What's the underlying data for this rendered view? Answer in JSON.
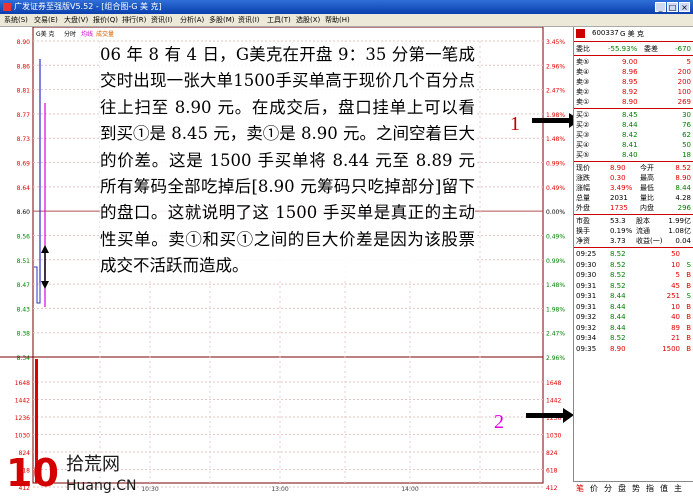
{
  "window": {
    "title": "广发证券至强版V5.52 - [组合图-G 美 克]",
    "buttons": [
      "_",
      "□",
      "×"
    ]
  },
  "menu": [
    "系统(S)",
    "交易(E)",
    "大盘(V)",
    "报价(Q)",
    "排行(R)",
    "资讯(I)",
    "分析(A)",
    "多股(M)",
    "资讯(I)",
    "工具(T)",
    "选股(X)",
    "帮助(H)"
  ],
  "chart_legend": {
    "name": "G美 克",
    "mode": "分时",
    "avg": "均线",
    "vol": "成交量"
  },
  "price_axis": [
    "8.90",
    "8.86",
    "8.81",
    "8.77",
    "8.73",
    "8.69",
    "8.64",
    "8.60",
    "8.56",
    "8.51",
    "8.47",
    "8.43",
    "8.38",
    "8.34"
  ],
  "pct_axis": [
    "3.45%",
    "2.96%",
    "2.47%",
    "1.98%",
    "1.48%",
    "0.99%",
    "0.49%",
    "0.00%",
    "0.49%",
    "0.99%",
    "1.48%",
    "1.98%",
    "2.47%",
    "2.96%"
  ],
  "vol_axis": [
    "1648",
    "1442",
    "1236",
    "1030",
    "824",
    "618",
    "412",
    "206"
  ],
  "time_axis": [
    "10:30",
    "13:00",
    "14:00"
  ],
  "panel": {
    "code": "600337",
    "name": "G 美 克",
    "weibi_label": "委比",
    "weibi_val": "-55.93%",
    "weicha_label": "委差",
    "weicha_val": "-670",
    "asks": [
      {
        "label": "卖⑤",
        "price": "9.00",
        "vol": "5"
      },
      {
        "label": "卖④",
        "price": "8.96",
        "vol": "200"
      },
      {
        "label": "卖③",
        "price": "8.95",
        "vol": "200"
      },
      {
        "label": "卖②",
        "price": "8.92",
        "vol": "100"
      },
      {
        "label": "卖①",
        "price": "8.90",
        "vol": "269"
      }
    ],
    "bids": [
      {
        "label": "买①",
        "price": "8.45",
        "vol": "30"
      },
      {
        "label": "买②",
        "price": "8.44",
        "vol": "76"
      },
      {
        "label": "买③",
        "price": "8.42",
        "vol": "62"
      },
      {
        "label": "买④",
        "price": "8.41",
        "vol": "50"
      },
      {
        "label": "买⑤",
        "price": "8.40",
        "vol": "18"
      }
    ],
    "stats": [
      {
        "l1": "现价",
        "v1": "8.90",
        "l2": "今开",
        "v2": "8.52"
      },
      {
        "l1": "涨跌",
        "v1": "0.30",
        "l2": "最高",
        "v2": "8.90"
      },
      {
        "l1": "涨幅",
        "v1": "3.49%",
        "l2": "最低",
        "v2": "8.44"
      },
      {
        "l1": "总量",
        "v1": "2031",
        "l2": "量比",
        "v2": "4.28"
      },
      {
        "l1": "外盘",
        "v1": "1735",
        "l2": "内盘",
        "v2": "296"
      }
    ],
    "fund": [
      {
        "l1": "市盈",
        "v1": "53.3",
        "l2": "股本",
        "v2": "1.99亿"
      },
      {
        "l1": "换手",
        "v1": "0.19%",
        "l2": "流通",
        "v2": "1.08亿"
      },
      {
        "l1": "净资",
        "v1": "3.73",
        "l2": "收益(一)",
        "v2": "0.04"
      }
    ],
    "ticks": [
      {
        "t": "09:25",
        "p": "8.52",
        "v": "50",
        "s": ""
      },
      {
        "t": "09:30",
        "p": "8.52",
        "v": "10",
        "s": "S"
      },
      {
        "t": "09:30",
        "p": "8.52",
        "v": "5",
        "s": "B"
      },
      {
        "t": "09:31",
        "p": "8.52",
        "v": "45",
        "s": "B"
      },
      {
        "t": "09:31",
        "p": "8.44",
        "v": "251",
        "s": "S"
      },
      {
        "t": "09:31",
        "p": "8.44",
        "v": "10",
        "s": "B"
      },
      {
        "t": "09:32",
        "p": "8.44",
        "v": "40",
        "s": "B"
      },
      {
        "t": "09:32",
        "p": "8.44",
        "v": "89",
        "s": "B"
      },
      {
        "t": "09:34",
        "p": "8.52",
        "v": "21",
        "s": "B"
      },
      {
        "t": "09:35",
        "p": "8.90",
        "v": "1500",
        "s": "B"
      }
    ],
    "tabs": [
      "笔",
      "价",
      "分",
      "盘",
      "势",
      "指",
      "值",
      "主"
    ]
  },
  "annotation": {
    "text": "06 年 8 有 4 日，G美克在开盘 9：35 分第一笔成交时出现一张大单1500手买单高于现价几个百分点往上扫至 8.90 元。在成交后，盘口挂单上可以看到买①是 8.45 元，卖①是 8.90 元。之间空着巨大的价差。这是 1500 手买单将 8.44 元至 8.89 元所有筹码全部吃掉后[8.90 元筹码只吃掉部分]留下的盘口。这就说明了这 1500 手买单是真正的主动性买单。卖①和买①之间的巨大价差是因为该股票成交不活跃而造成。",
    "marker1": "1",
    "marker2": "2"
  },
  "watermark": {
    "cn": "拾荒网",
    "en": "Huang.CN",
    "num": "10"
  },
  "colors": {
    "up": "#e00000",
    "down": "#008000",
    "grid": "#d9b3b3",
    "accent": "#7a0000"
  }
}
